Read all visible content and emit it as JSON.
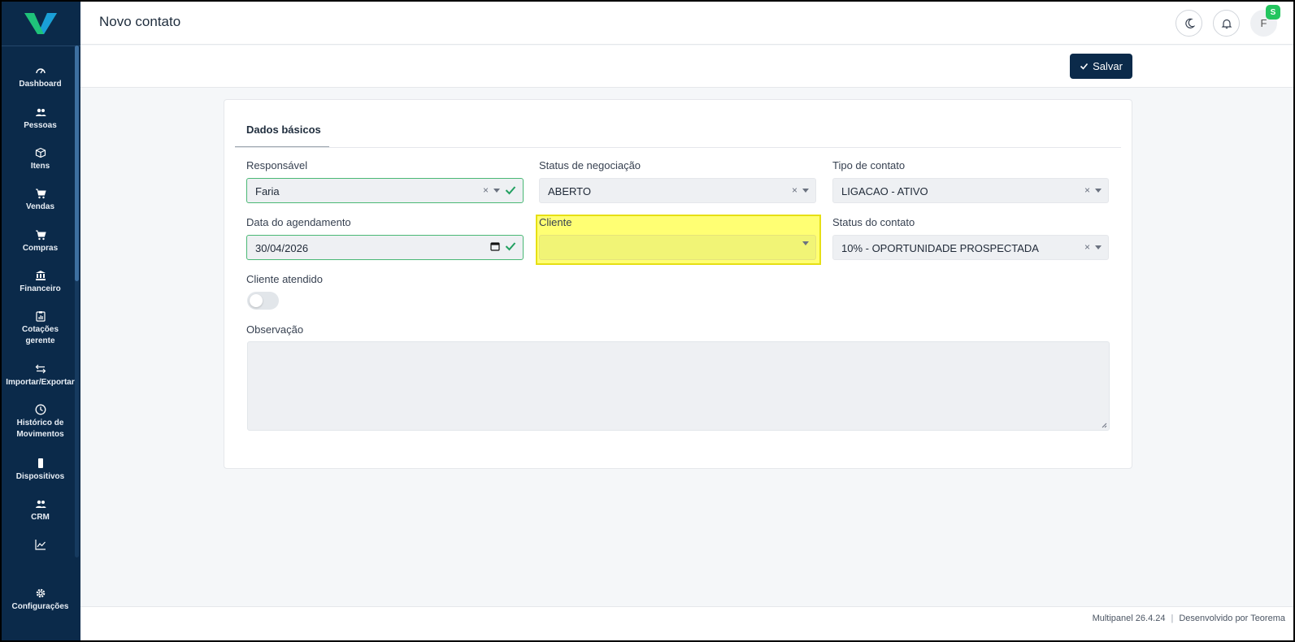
{
  "header": {
    "title": "Novo contato",
    "avatar_initial": "F",
    "avatar_badge": "S"
  },
  "toolbar": {
    "save_label": "Salvar"
  },
  "sidebar": {
    "items": [
      {
        "label": "Dashboard",
        "icon": "gauge-icon"
      },
      {
        "label": "Pessoas",
        "icon": "people-icon"
      },
      {
        "label": "Itens",
        "icon": "box-icon"
      },
      {
        "label": "Vendas",
        "icon": "cart-icon"
      },
      {
        "label": "Compras",
        "icon": "cart-icon"
      },
      {
        "label": "Financeiro",
        "icon": "bank-icon"
      },
      {
        "label": "Cotações gerente",
        "icon": "clipboard-icon"
      },
      {
        "label": "Importar/Exportar",
        "icon": "swap-icon"
      },
      {
        "label": "Histórico de Movimentos",
        "icon": "clock-icon"
      },
      {
        "label": "Dispositivos",
        "icon": "phone-icon"
      },
      {
        "label": "CRM",
        "icon": "people-icon"
      },
      {
        "label": "",
        "icon": "chart-line-icon"
      },
      {
        "label": "Configurações",
        "icon": "gear-icon"
      }
    ]
  },
  "form": {
    "tab": "Dados básicos",
    "responsavel": {
      "label": "Responsável",
      "value": "Faria"
    },
    "status_negociacao": {
      "label": "Status de negociação",
      "value": "ABERTO"
    },
    "tipo_contato": {
      "label": "Tipo de contato",
      "value": "LIGACAO - ATIVO"
    },
    "data_agendamento": {
      "label": "Data do agendamento",
      "value": "30/04/2026"
    },
    "cliente": {
      "label": "Cliente",
      "value": ""
    },
    "status_contato": {
      "label": "Status do contato",
      "value": "10% - OPORTUNIDADE PROSPECTADA"
    },
    "cliente_atendido": {
      "label": "Cliente atendido",
      "checked": false
    },
    "observacao": {
      "label": "Observação",
      "value": ""
    }
  },
  "footer": {
    "version": "Multipanel  26.4.24",
    "developer": "Desenvolvido por Teorema"
  },
  "colors": {
    "sidebar": "#0b2a4a",
    "primary_button": "#0b2a4a",
    "valid": "#22a061",
    "highlight": "#ffff00",
    "badge": "#22c55e"
  }
}
